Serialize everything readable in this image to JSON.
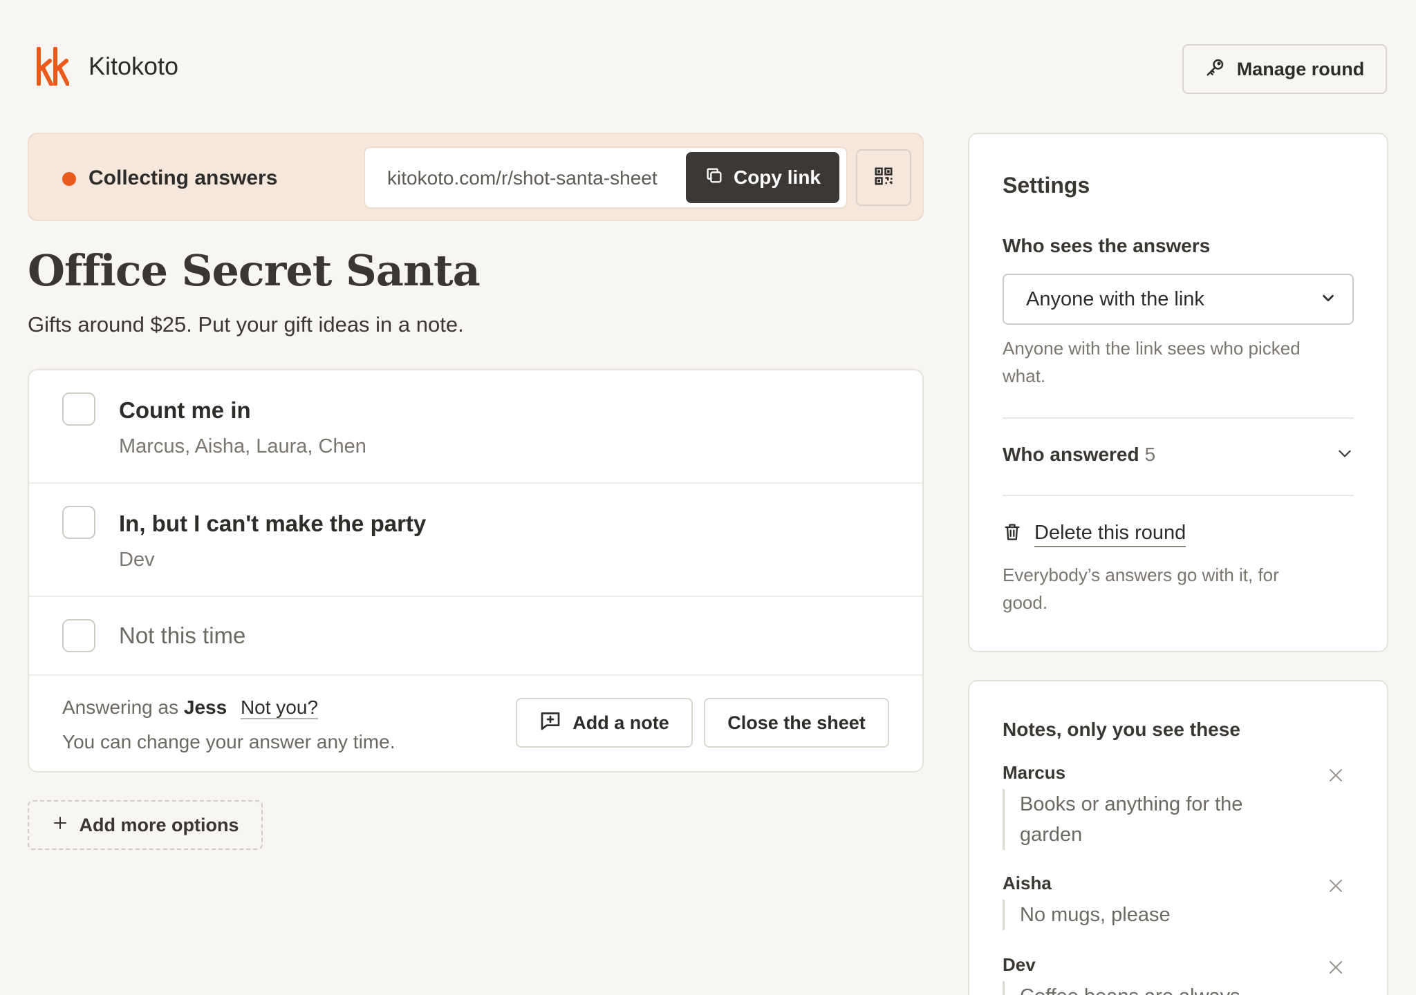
{
  "brand": {
    "name": "Kitokoto",
    "logo_text": "kk",
    "accent": "#ea5a1c"
  },
  "header": {
    "manage_label": "Manage round"
  },
  "status": {
    "label": "Collecting answers",
    "link": "kitokoto.com/r/shot-santa-sheet",
    "copy_label": "Copy link"
  },
  "round": {
    "title": "Office Secret Santa",
    "description": "Gifts around $25. Put your gift ideas in a note."
  },
  "options": [
    {
      "label": "Count me in",
      "names": "Marcus, Aisha, Laura, Chen",
      "checked": false
    },
    {
      "label": "In, but I can't make the party",
      "names": "Dev",
      "checked": false
    },
    {
      "label": "Not this time",
      "names": "",
      "checked": false
    }
  ],
  "footer": {
    "answering_as_prefix": "Answering as",
    "user": "Jess",
    "not_you": "Not you?",
    "hint": "You can change your answer any time.",
    "add_note_label": "Add a note",
    "close_label": "Close the sheet"
  },
  "add_more_label": "Add more options",
  "settings": {
    "title": "Settings",
    "visibility_label": "Who sees the answers",
    "visibility_value": "Anyone with the link",
    "visibility_help": "Anyone with the link sees who picked what.",
    "answered_label": "Who answered",
    "answered_count": "5",
    "delete_label": "Delete this round",
    "delete_help": "Everybody’s answers go with it, for good."
  },
  "notes": {
    "title": "Notes, only you see these",
    "items": [
      {
        "author": "Marcus",
        "text": "Books or anything for the garden"
      },
      {
        "author": "Aisha",
        "text": "No mugs, please"
      },
      {
        "author": "Dev",
        "text": "Coffee beans are always good"
      }
    ]
  }
}
